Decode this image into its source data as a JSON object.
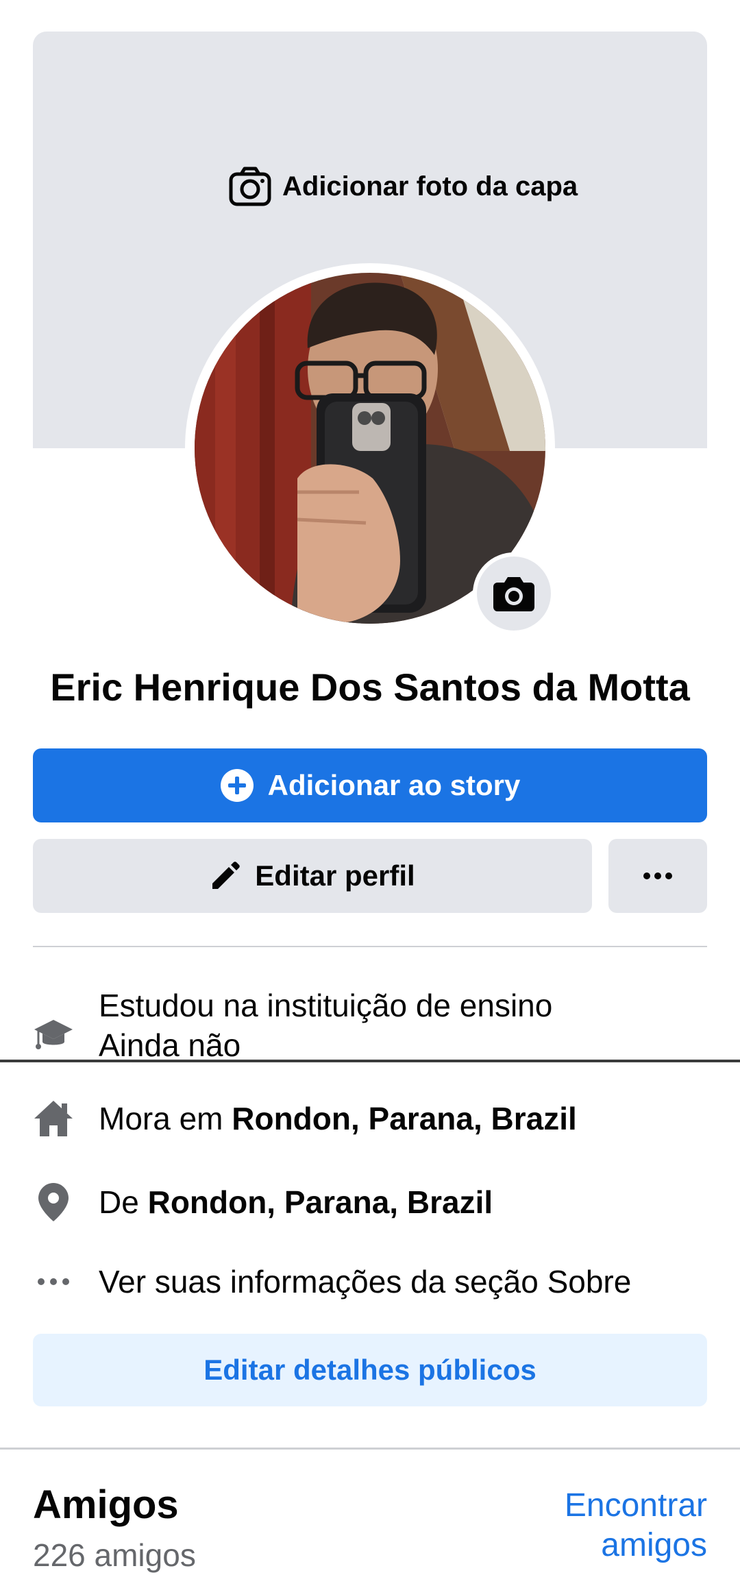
{
  "cover": {
    "add_cover_label": "Adicionar foto da capa",
    "background_color": "#e4e6eb"
  },
  "profile": {
    "name": "Eric Henrique Dos Santos da Motta"
  },
  "actions": {
    "add_story_label": "Adicionar ao story",
    "edit_profile_label": "Editar perfil",
    "more_icon": "more-horizontal-icon",
    "primary_color": "#1b74e4"
  },
  "info": {
    "education": {
      "icon": "graduation-cap-icon",
      "line1": "Estudou na instituição de ensino",
      "line2": "Ainda não"
    },
    "lives_in": {
      "icon": "home-icon",
      "prefix": "Mora em",
      "place": "Rondon, Parana, Brazil"
    },
    "from": {
      "icon": "location-pin-icon",
      "prefix": "De",
      "place": "Rondon, Parana, Brazil"
    },
    "about": {
      "icon": "more-horizontal-icon",
      "label": "Ver suas informações da seção Sobre"
    },
    "edit_public_label": "Editar detalhes públicos"
  },
  "friends": {
    "title": "Amigos",
    "count": "226 amigos",
    "find_label": "Encontrar amigos"
  }
}
